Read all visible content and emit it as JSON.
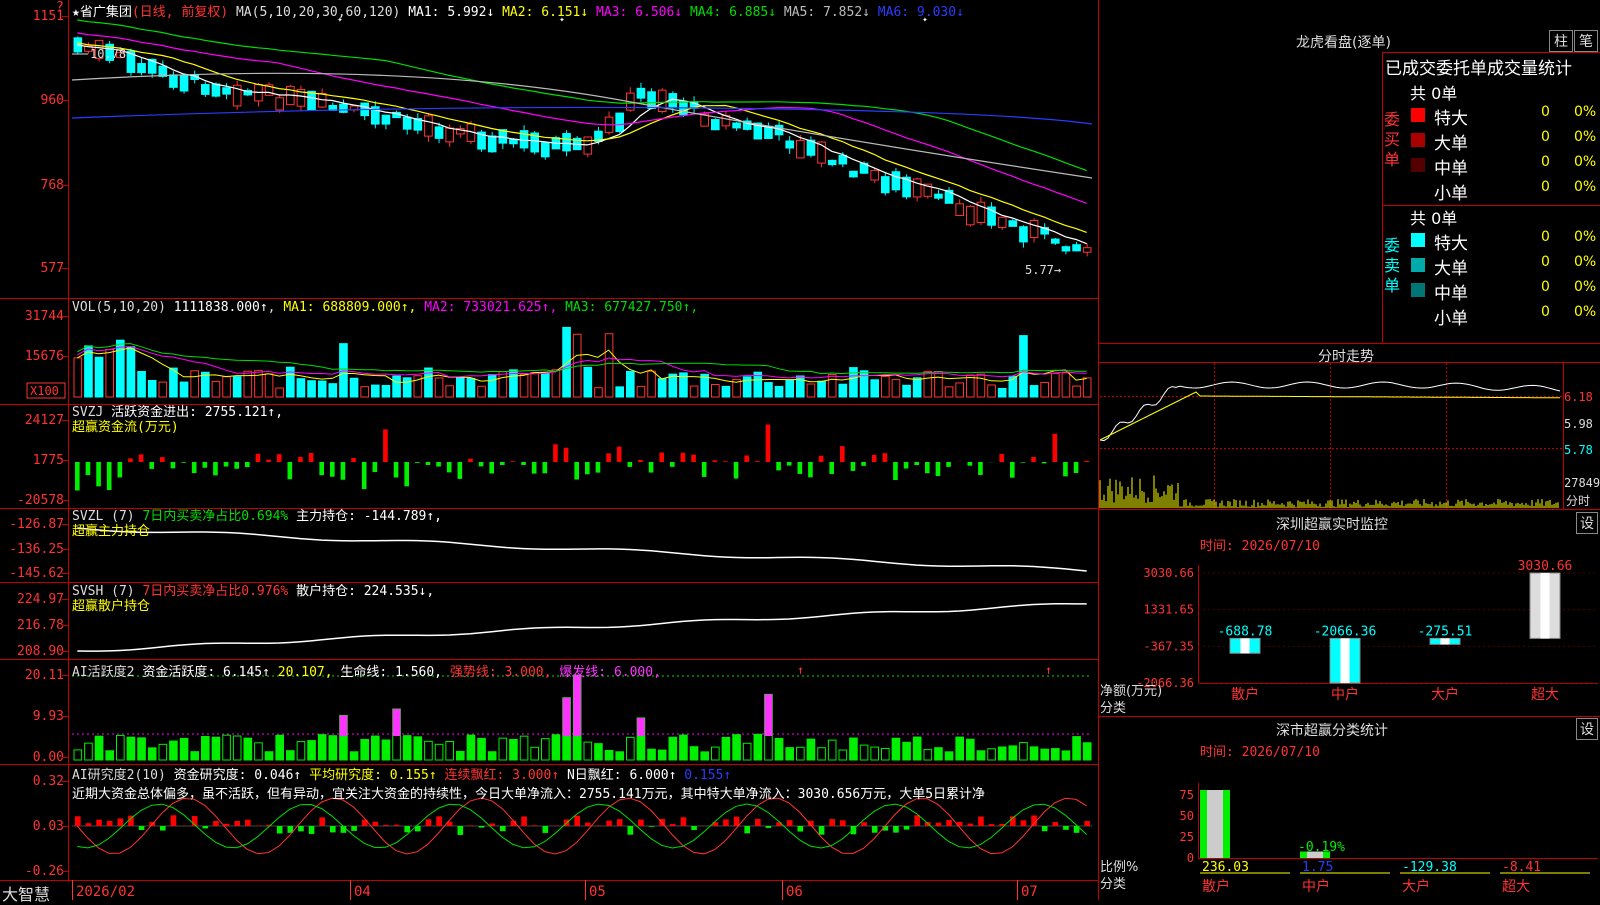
{
  "stock": {
    "name": "省广集团",
    "mode": "(日线, 前复权)"
  },
  "price_panel": {
    "ma_header": "MA(5,10,20,30,60,120)",
    "ma": [
      {
        "label": "MA1:",
        "value": "5.992↓",
        "color": "#ffffff"
      },
      {
        "label": "MA2:",
        "value": "6.151↓",
        "color": "#ffff00"
      },
      {
        "label": "MA3:",
        "value": "6.506↓",
        "color": "#ff00ff"
      },
      {
        "label": "MA4:",
        "value": "6.885↓",
        "color": "#00dd00"
      },
      {
        "label": "MA5:",
        "value": "7.852↓",
        "color": "#bbbbbb"
      },
      {
        "label": "MA6:",
        "value": "9.030↓",
        "color": "#2a3cff"
      }
    ],
    "y_ticks": [
      "1151",
      "960",
      "768",
      "577"
    ],
    "high_label": "10.78",
    "low_label": "5.77"
  },
  "vol_panel": {
    "title": "VOL(5,10,20)",
    "value": "1111838.000↑",
    "ma": [
      {
        "text": "MA1: 688809.000↑",
        "color": "#ffff00"
      },
      {
        "text": "MA2: 733021.625↑",
        "color": "#ff00ff"
      },
      {
        "text": "MA3: 677427.750↑",
        "color": "#00dd00"
      }
    ],
    "y_ticks": [
      "31744",
      "15676"
    ],
    "unit": "X100"
  },
  "svzj_panel": {
    "title": "SVZJ",
    "line1": "活跃资金进出: 2755.121↑,",
    "line2": "超赢资金流(万元)",
    "y_ticks": [
      "24127",
      "1775",
      "-20578"
    ]
  },
  "svzl_panel": {
    "title": "SVZL (7)",
    "ratio": "7日内买卖净占比0.694%",
    "hold": "主力持仓: -144.789↑,",
    "line2": "超赢主力持仓",
    "y_ticks": [
      "-126.87",
      "-136.25",
      "-145.62"
    ]
  },
  "svsh_panel": {
    "title": "SVSH (7)",
    "ratio": "7日内买卖净占比0.976%",
    "hold": "散户持仓: 224.535↓,",
    "line2": "超赢散户持仓",
    "y_ticks": [
      "224.97",
      "216.78",
      "208.90"
    ]
  },
  "ai1_panel": {
    "title": "AI活跃度2",
    "items": [
      {
        "text": "资金活跃度: 6.145↑",
        "color": "#ffffff"
      },
      {
        "text": "20.107,",
        "color": "#ffff00"
      },
      {
        "text": "生命线: 1.560,",
        "color": "#ffffff"
      },
      {
        "text": "强势线: 3.000,",
        "color": "#ff3333"
      },
      {
        "text": "爆发线: 6.000,",
        "color": "#ff33ff"
      }
    ],
    "y_ticks": [
      "20.11",
      "9.93",
      "0.00"
    ]
  },
  "ai2_panel": {
    "title": "AI研究度2(10)",
    "items": [
      {
        "text": "资金研究度: 0.046↑",
        "color": "#ffffff"
      },
      {
        "text": "平均研究度: 0.155↑",
        "color": "#ffff00"
      },
      {
        "text": "连续飘红: 3.000↑",
        "color": "#ff3333"
      },
      {
        "text": "N日飘红: 6.000↑",
        "color": "#ffffff"
      },
      {
        "text": "0.155↑",
        "color": "#2a3cff"
      }
    ],
    "comment": "近期大资金总体偏多，虽不活跃，但有异动，宜关注大资金的持续性，今日大单净流入：2755.141万元，其中特大单净流入：3030.656万元，大单5日累计净",
    "y_ticks": [
      "0.32",
      "0.03",
      "-0.26"
    ]
  },
  "x_axis": {
    "brand": "大智慧",
    "labels": [
      "2026/02",
      "04",
      "05",
      "06",
      "07"
    ]
  },
  "right_panel": {
    "dragon_title": "龙虎看盘(逐单)",
    "tab_bar": "柱",
    "tab_pen": "笔",
    "header": "已成交委托单成交量统计",
    "buy": {
      "side": "委买单",
      "total": "共 0单",
      "rows": [
        {
          "label": "特大",
          "count": "0",
          "pct": "0%",
          "color": "#ff0000"
        },
        {
          "label": "大单",
          "count": "0",
          "pct": "0%",
          "color": "#aa0000"
        },
        {
          "label": "中单",
          "count": "0",
          "pct": "0%",
          "color": "#550000"
        },
        {
          "label": "小单",
          "count": "0",
          "pct": "0%",
          "color": "#000000"
        }
      ]
    },
    "sell": {
      "side": "委卖单",
      "total": "共 0单",
      "rows": [
        {
          "label": "特大",
          "count": "0",
          "pct": "0%",
          "color": "#00ffff"
        },
        {
          "label": "大单",
          "count": "0",
          "pct": "0%",
          "color": "#00aaaa"
        },
        {
          "label": "中单",
          "count": "0",
          "pct": "0%",
          "color": "#007777"
        },
        {
          "label": "小单",
          "count": "0",
          "pct": "0%",
          "color": "#000000"
        }
      ]
    },
    "intraday": {
      "title": "分时走势",
      "y_ticks": [
        "6.18",
        "5.98",
        "5.78"
      ],
      "vol_tick": "27849",
      "vol_unit": "分时"
    },
    "monitor": {
      "title": "深圳超赢实时监控",
      "settings": "设",
      "time": "时间: 2026/07/10",
      "y_ticks": [
        "3030.66",
        "1331.65",
        "-367.35",
        "-2066.36"
      ],
      "ylabel": "净额(万元)",
      "xlabel": "分类"
    },
    "classify": {
      "title": "深市超赢分类统计",
      "settings": "设",
      "time": "时间: 2026/07/10",
      "y_ticks": [
        "75",
        "50",
        "25",
        "0"
      ],
      "ylabel": "比例%",
      "xlabel": "分类"
    }
  },
  "chart_data": [
    {
      "type": "bar",
      "title": "深圳超赢实时监控",
      "ylabel": "净额(万元)",
      "categories": [
        "散户",
        "中户",
        "大户",
        "超大"
      ],
      "values": [
        -688.78,
        -2066.36,
        -275.51,
        3030.66
      ],
      "ylim": [
        -2066.36,
        3030.66
      ]
    },
    {
      "type": "bar",
      "title": "深市超赢分类统计",
      "ylabel": "比例%",
      "categories": [
        "散户",
        "中户",
        "大户",
        "超大"
      ],
      "values": [
        236.03,
        1.75,
        -129.38,
        -8.41
      ],
      "annotations": [
        "-0.19%"
      ],
      "ylim": [
        0,
        75
      ]
    }
  ]
}
